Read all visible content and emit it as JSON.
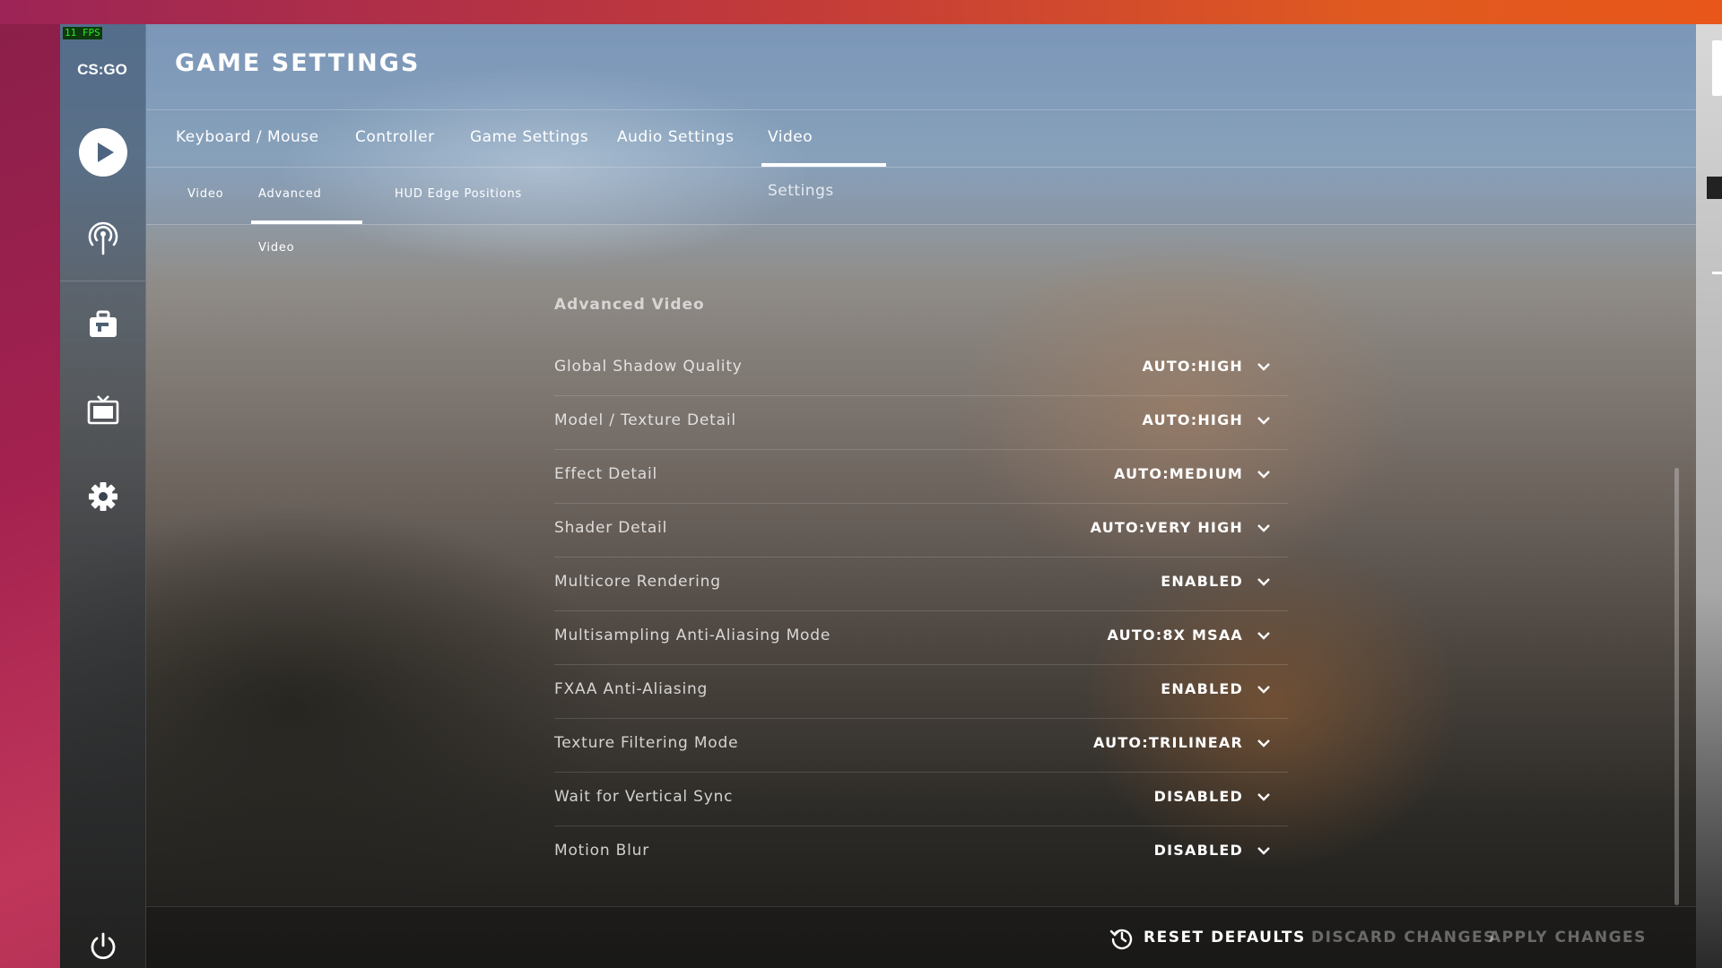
{
  "fps_counter": "11 FPS",
  "logo_text": "CS:GO",
  "page_title": "GAME SETTINGS",
  "nav": {
    "icons": [
      "play-icon",
      "broadcast-icon",
      "inventory-briefcase-icon",
      "watch-tv-icon",
      "settings-gear-icon",
      "power-icon"
    ]
  },
  "tabs": [
    {
      "label": "Keyboard / Mouse",
      "active": false
    },
    {
      "label": "Controller",
      "active": false
    },
    {
      "label": "Game Settings",
      "active": false
    },
    {
      "label": "Audio Settings",
      "active": false
    },
    {
      "label": "Video Settings",
      "active": true
    }
  ],
  "subtabs": [
    {
      "label": "Video",
      "active": false
    },
    {
      "label": "Advanced Video",
      "active": true
    },
    {
      "label": "HUD Edge Positions",
      "active": false
    }
  ],
  "panel": {
    "title": "Advanced Video",
    "settings": [
      {
        "label": "Global Shadow Quality",
        "value": "AUTO:HIGH"
      },
      {
        "label": "Model / Texture Detail",
        "value": "AUTO:HIGH"
      },
      {
        "label": "Effect Detail",
        "value": "AUTO:MEDIUM"
      },
      {
        "label": "Shader Detail",
        "value": "AUTO:VERY HIGH"
      },
      {
        "label": "Multicore Rendering",
        "value": "ENABLED"
      },
      {
        "label": "Multisampling Anti-Aliasing Mode",
        "value": "AUTO:8X MSAA"
      },
      {
        "label": "FXAA Anti-Aliasing",
        "value": "ENABLED"
      },
      {
        "label": "Texture Filtering Mode",
        "value": "AUTO:TRILINEAR"
      },
      {
        "label": "Wait for Vertical Sync",
        "value": "DISABLED"
      },
      {
        "label": "Motion Blur",
        "value": "DISABLED"
      }
    ]
  },
  "footer": {
    "reset_label": "RESET DEFAULTS",
    "discard_label": "DISCARD CHANGES",
    "apply_label": "APPLY CHANGES"
  },
  "colors": {
    "accent": "#ffffff",
    "fps_text": "#2ee82e",
    "disabled_text": "#8a8a8a"
  }
}
